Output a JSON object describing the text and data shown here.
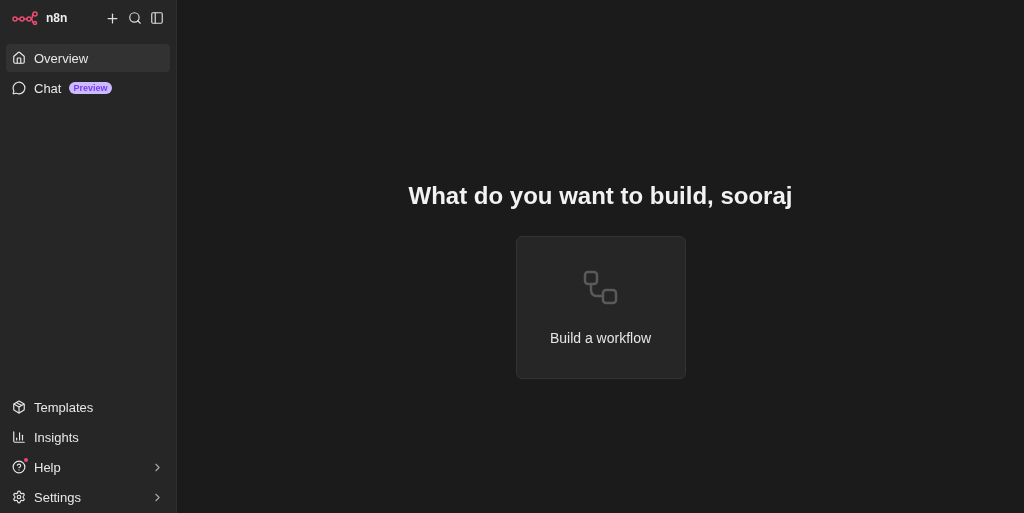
{
  "sidebar": {
    "brand": "n8n",
    "top_items": [
      {
        "label": "Overview",
        "selected": true
      },
      {
        "label": "Chat",
        "selected": false,
        "badge": "Preview"
      }
    ],
    "bottom_items": [
      {
        "label": "Templates",
        "selected": false,
        "expandable": false,
        "notification": false
      },
      {
        "label": "Insights",
        "selected": false,
        "expandable": false,
        "notification": false
      },
      {
        "label": "Help",
        "selected": false,
        "expandable": true,
        "notification": true
      },
      {
        "label": "Settings",
        "selected": false,
        "expandable": true,
        "notification": false
      }
    ]
  },
  "main": {
    "heading": "What do you want to build, sooraj",
    "card": {
      "label": "Build a workflow"
    }
  }
}
